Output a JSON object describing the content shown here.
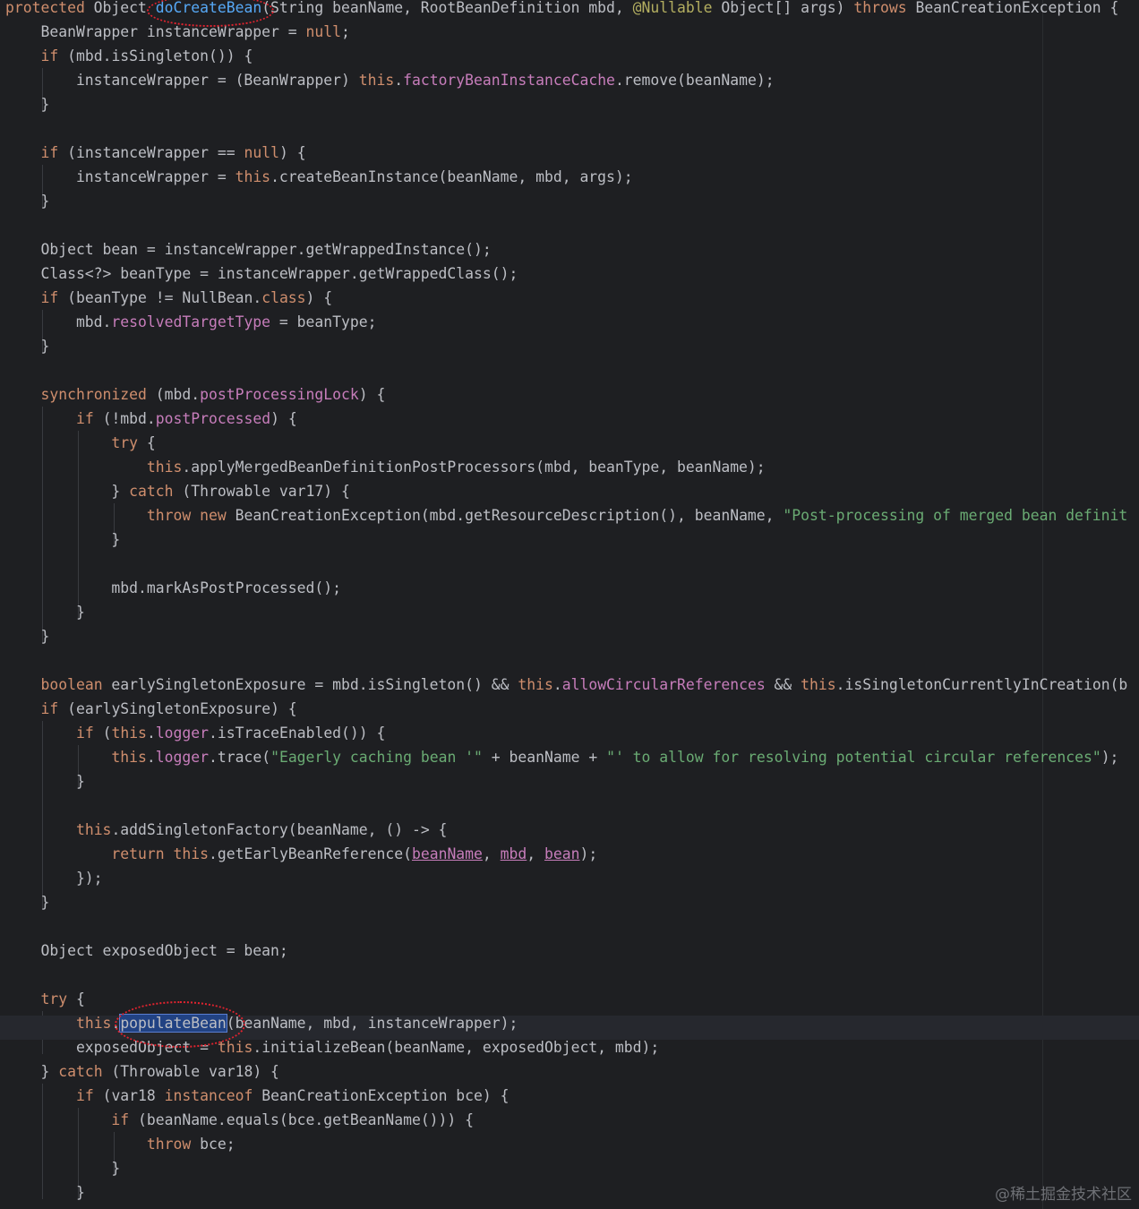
{
  "colors": {
    "background": "#1e1f22",
    "default_text": "#bcbec4",
    "keyword": "#cf8e6d",
    "method_declaration": "#56a8f5",
    "annotation": "#b3ae60",
    "field": "#c77dbb",
    "string": "#6aab73",
    "selection": "#214283",
    "annotation_ring": "#e2232f"
  },
  "current_line": 42,
  "highlighted_identifiers": [
    "doCreateBean",
    "populateBean"
  ],
  "selected_identifier": "populateBean",
  "watermark": "@稀土掘金技术社区",
  "lines": [
    [
      [
        "protected",
        "kw"
      ],
      [
        " Object "
      ],
      [
        "doCreateBean",
        "fn"
      ],
      [
        "(String beanName, RootBeanDefinition mbd, "
      ],
      [
        "@Nullable",
        "ann"
      ],
      [
        " Object[] args) "
      ],
      [
        "throws",
        "kw"
      ],
      [
        " BeanCreationException {"
      ]
    ],
    [
      [
        "    BeanWrapper instanceWrapper = "
      ],
      [
        "null",
        "kw"
      ],
      [
        ";"
      ]
    ],
    [
      [
        "    "
      ],
      [
        "if",
        "kw"
      ],
      [
        " (mbd.isSingleton()) {"
      ]
    ],
    [
      [
        "        instanceWrapper = (BeanWrapper) "
      ],
      [
        "this",
        "kw"
      ],
      [
        "."
      ],
      [
        "factoryBeanInstanceCache",
        "fld"
      ],
      [
        ".remove(beanName);"
      ]
    ],
    [
      [
        "    }"
      ]
    ],
    [],
    [
      [
        "    "
      ],
      [
        "if",
        "kw"
      ],
      [
        " (instanceWrapper == "
      ],
      [
        "null",
        "kw"
      ],
      [
        ") {"
      ]
    ],
    [
      [
        "        instanceWrapper = "
      ],
      [
        "this",
        "kw"
      ],
      [
        ".createBeanInstance(beanName, mbd, args);"
      ]
    ],
    [
      [
        "    }"
      ]
    ],
    [],
    [
      [
        "    Object bean = instanceWrapper.getWrappedInstance();"
      ]
    ],
    [
      [
        "    Class<?> beanType = instanceWrapper.getWrappedClass();"
      ]
    ],
    [
      [
        "    "
      ],
      [
        "if",
        "kw"
      ],
      [
        " (beanType != NullBean."
      ],
      [
        "class",
        "kw"
      ],
      [
        ") {"
      ]
    ],
    [
      [
        "        mbd."
      ],
      [
        "resolvedTargetType",
        "fld"
      ],
      [
        " = beanType;"
      ]
    ],
    [
      [
        "    }"
      ]
    ],
    [],
    [
      [
        "    "
      ],
      [
        "synchronized",
        "kw"
      ],
      [
        " (mbd."
      ],
      [
        "postProcessingLock",
        "fld"
      ],
      [
        ") {"
      ]
    ],
    [
      [
        "        "
      ],
      [
        "if",
        "kw"
      ],
      [
        " (!mbd."
      ],
      [
        "postProcessed",
        "fld"
      ],
      [
        ") {"
      ]
    ],
    [
      [
        "            "
      ],
      [
        "try",
        "kw"
      ],
      [
        " {"
      ]
    ],
    [
      [
        "                "
      ],
      [
        "this",
        "kw"
      ],
      [
        ".applyMergedBeanDefinitionPostProcessors(mbd, beanType, beanName);"
      ]
    ],
    [
      [
        "            } "
      ],
      [
        "catch",
        "kw"
      ],
      [
        " (Throwable var17) {"
      ]
    ],
    [
      [
        "                "
      ],
      [
        "throw",
        "kw"
      ],
      [
        " "
      ],
      [
        "new",
        "kw"
      ],
      [
        " BeanCreationException(mbd.getResourceDescription(), beanName, "
      ],
      [
        "\"Post-processing of merged bean definit",
        "str"
      ]
    ],
    [
      [
        "            }"
      ]
    ],
    [],
    [
      [
        "            mbd.markAsPostProcessed();"
      ]
    ],
    [
      [
        "        }"
      ]
    ],
    [
      [
        "    }"
      ]
    ],
    [],
    [
      [
        "    "
      ],
      [
        "boolean",
        "kw"
      ],
      [
        " earlySingletonExposure = mbd.isSingleton() && "
      ],
      [
        "this",
        "kw"
      ],
      [
        "."
      ],
      [
        "allowCircularReferences",
        "fld"
      ],
      [
        " && "
      ],
      [
        "this",
        "kw"
      ],
      [
        ".isSingletonCurrentlyInCreation(b"
      ]
    ],
    [
      [
        "    "
      ],
      [
        "if",
        "kw"
      ],
      [
        " (earlySingletonExposure) {"
      ]
    ],
    [
      [
        "        "
      ],
      [
        "if",
        "kw"
      ],
      [
        " ("
      ],
      [
        "this",
        "kw"
      ],
      [
        "."
      ],
      [
        "logger",
        "fld"
      ],
      [
        ".isTraceEnabled()) {"
      ]
    ],
    [
      [
        "            "
      ],
      [
        "this",
        "kw"
      ],
      [
        "."
      ],
      [
        "logger",
        "fld"
      ],
      [
        ".trace("
      ],
      [
        "\"Eagerly caching bean '\"",
        "str"
      ],
      [
        " + beanName + "
      ],
      [
        "\"' to allow for resolving potential circular references\"",
        "str"
      ],
      [
        ");"
      ]
    ],
    [
      [
        "        }"
      ]
    ],
    [],
    [
      [
        "        "
      ],
      [
        "this",
        "kw"
      ],
      [
        ".addSingletonFactory(beanName, () -> {"
      ]
    ],
    [
      [
        "            "
      ],
      [
        "return",
        "kw"
      ],
      [
        " "
      ],
      [
        "this",
        "kw"
      ],
      [
        ".getEarlyBeanReference("
      ],
      [
        "beanName",
        "fld-ul"
      ],
      [
        ", "
      ],
      [
        "mbd",
        "fld-ul"
      ],
      [
        ", "
      ],
      [
        "bean",
        "fld-ul"
      ],
      [
        ");"
      ]
    ],
    [
      [
        "        });"
      ]
    ],
    [
      [
        "    }"
      ]
    ],
    [],
    [
      [
        "    Object exposedObject = bean;"
      ]
    ],
    [],
    [
      [
        "    "
      ],
      [
        "try",
        "kw"
      ],
      [
        " {"
      ]
    ],
    [
      [
        "        "
      ],
      [
        "this",
        "kw"
      ],
      [
        "."
      ],
      [
        "populateBean",
        "sel"
      ],
      [
        "(beanName, mbd, instanceWrapper);"
      ]
    ],
    [
      [
        "        exposedObject = "
      ],
      [
        "this",
        "kw"
      ],
      [
        ".initializeBean(beanName, exposedObject, mbd);"
      ]
    ],
    [
      [
        "    } "
      ],
      [
        "catch",
        "kw"
      ],
      [
        " (Throwable var18) {"
      ]
    ],
    [
      [
        "        "
      ],
      [
        "if",
        "kw"
      ],
      [
        " (var18 "
      ],
      [
        "instanceof",
        "kw"
      ],
      [
        " BeanCreationException bce) {"
      ]
    ],
    [
      [
        "            "
      ],
      [
        "if",
        "kw"
      ],
      [
        " (beanName.equals(bce.getBeanName())) {"
      ]
    ],
    [
      [
        "                "
      ],
      [
        "throw",
        "kw"
      ],
      [
        " bce;"
      ]
    ],
    [
      [
        "            }"
      ]
    ],
    [
      [
        "        }"
      ]
    ]
  ]
}
